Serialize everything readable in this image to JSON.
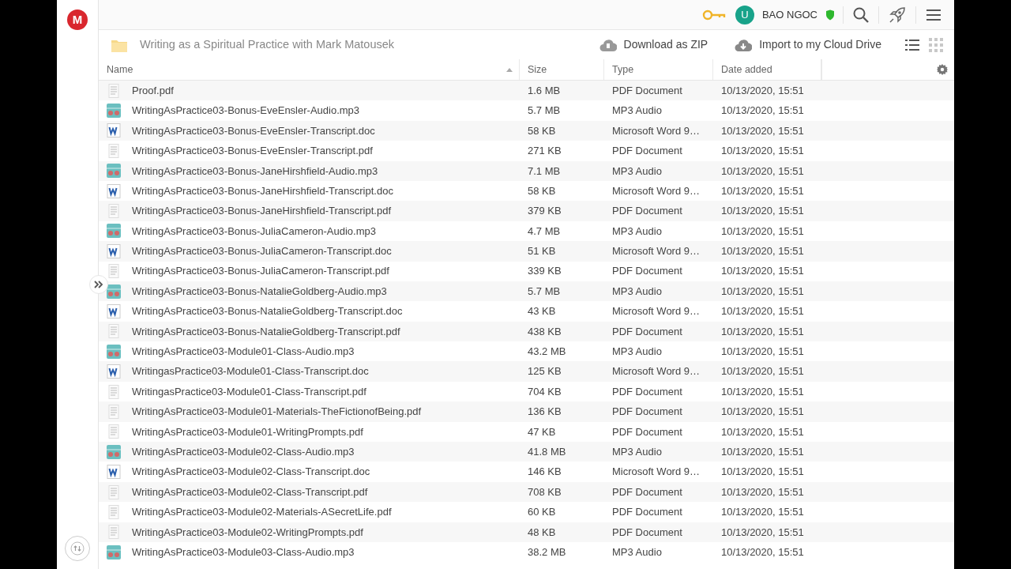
{
  "logo": {
    "letter": "M"
  },
  "topbar": {
    "user_initial": "U",
    "user_name": "BAO NGOC"
  },
  "folder": {
    "title": "Writing as a Spiritual Practice with Mark Matousek"
  },
  "actions": [
    {
      "label": "Download as ZIP",
      "kind": "zip"
    },
    {
      "label": "Import to my Cloud Drive",
      "kind": "cloud"
    }
  ],
  "view_modes": [
    {
      "kind": "list",
      "selected": true
    },
    {
      "kind": "grid",
      "selected": false
    }
  ],
  "table": {
    "columns": [
      {
        "label": "Name",
        "sorted": true
      },
      {
        "label": "Size",
        "sorted": false
      },
      {
        "label": "Type",
        "sorted": false
      },
      {
        "label": "Date added",
        "sorted": false
      }
    ],
    "rows": [
      {
        "kind": "pdf",
        "name": "Proof.pdf",
        "size": "1.6 MB",
        "type": "PDF Document",
        "date": "10/13/2020, 15:51"
      },
      {
        "kind": "mp3",
        "name": "WritingAsPractice03-Bonus-EveEnsler-Audio.mp3",
        "size": "5.7 MB",
        "type": "MP3 Audio",
        "date": "10/13/2020, 15:51"
      },
      {
        "kind": "doc",
        "name": "WritingAsPractice03-Bonus-EveEnsler-Transcript.doc",
        "size": "58 KB",
        "type": "Microsoft Word 9…",
        "date": "10/13/2020, 15:51"
      },
      {
        "kind": "pdf",
        "name": "WritingAsPractice03-Bonus-EveEnsler-Transcript.pdf",
        "size": "271 KB",
        "type": "PDF Document",
        "date": "10/13/2020, 15:51"
      },
      {
        "kind": "mp3",
        "name": "WritingAsPractice03-Bonus-JaneHirshfield-Audio.mp3",
        "size": "7.1 MB",
        "type": "MP3 Audio",
        "date": "10/13/2020, 15:51"
      },
      {
        "kind": "doc",
        "name": "WritingAsPractice03-Bonus-JaneHirshfield-Transcript.doc",
        "size": "58 KB",
        "type": "Microsoft Word 9…",
        "date": "10/13/2020, 15:51"
      },
      {
        "kind": "pdf",
        "name": "WritingAsPractice03-Bonus-JaneHirshfield-Transcript.pdf",
        "size": "379 KB",
        "type": "PDF Document",
        "date": "10/13/2020, 15:51"
      },
      {
        "kind": "mp3",
        "name": "WritingAsPractice03-Bonus-JuliaCameron-Audio.mp3",
        "size": "4.7 MB",
        "type": "MP3 Audio",
        "date": "10/13/2020, 15:51"
      },
      {
        "kind": "doc",
        "name": "WritingAsPractice03-Bonus-JuliaCameron-Transcript.doc",
        "size": "51 KB",
        "type": "Microsoft Word 9…",
        "date": "10/13/2020, 15:51"
      },
      {
        "kind": "pdf",
        "name": "WritingAsPractice03-Bonus-JuliaCameron-Transcript.pdf",
        "size": "339 KB",
        "type": "PDF Document",
        "date": "10/13/2020, 15:51"
      },
      {
        "kind": "mp3",
        "name": "WritingAsPractice03-Bonus-NatalieGoldberg-Audio.mp3",
        "size": "5.7 MB",
        "type": "MP3 Audio",
        "date": "10/13/2020, 15:51"
      },
      {
        "kind": "doc",
        "name": "WritingAsPractice03-Bonus-NatalieGoldberg-Transcript.doc",
        "size": "43 KB",
        "type": "Microsoft Word 9…",
        "date": "10/13/2020, 15:51"
      },
      {
        "kind": "pdf",
        "name": "WritingAsPractice03-Bonus-NatalieGoldberg-Transcript.pdf",
        "size": "438 KB",
        "type": "PDF Document",
        "date": "10/13/2020, 15:51"
      },
      {
        "kind": "mp3",
        "name": "WritingAsPractice03-Module01-Class-Audio.mp3",
        "size": "43.2 MB",
        "type": "MP3 Audio",
        "date": "10/13/2020, 15:51"
      },
      {
        "kind": "doc",
        "name": "WritingasPractice03-Module01-Class-Transcript.doc",
        "size": "125 KB",
        "type": "Microsoft Word 9…",
        "date": "10/13/2020, 15:51"
      },
      {
        "kind": "pdf",
        "name": "WritingasPractice03-Module01-Class-Transcript.pdf",
        "size": "704 KB",
        "type": "PDF Document",
        "date": "10/13/2020, 15:51"
      },
      {
        "kind": "pdf",
        "name": "WritingAsPractice03-Module01-Materials-TheFictionofBeing.pdf",
        "size": "136 KB",
        "type": "PDF Document",
        "date": "10/13/2020, 15:51"
      },
      {
        "kind": "pdf",
        "name": "WritingAsPractice03-Module01-WritingPrompts.pdf",
        "size": "47 KB",
        "type": "PDF Document",
        "date": "10/13/2020, 15:51"
      },
      {
        "kind": "mp3",
        "name": "WritingAsPractice03-Module02-Class-Audio.mp3",
        "size": "41.8 MB",
        "type": "MP3 Audio",
        "date": "10/13/2020, 15:51"
      },
      {
        "kind": "doc",
        "name": "WritingAsPractice03-Module02-Class-Transcript.doc",
        "size": "146 KB",
        "type": "Microsoft Word 9…",
        "date": "10/13/2020, 15:51"
      },
      {
        "kind": "pdf",
        "name": "WritingAsPractice03-Module02-Class-Transcript.pdf",
        "size": "708 KB",
        "type": "PDF Document",
        "date": "10/13/2020, 15:51"
      },
      {
        "kind": "pdf",
        "name": "WritingAsPractice03-Module02-Materials-ASecretLife.pdf",
        "size": "60 KB",
        "type": "PDF Document",
        "date": "10/13/2020, 15:51"
      },
      {
        "kind": "pdf",
        "name": "WritingAsPractice03-Module02-WritingPrompts.pdf",
        "size": "48 KB",
        "type": "PDF Document",
        "date": "10/13/2020, 15:51"
      },
      {
        "kind": "mp3",
        "name": "WritingAsPractice03-Module03-Class-Audio.mp3",
        "size": "38.2 MB",
        "type": "MP3 Audio",
        "date": "10/13/2020, 15:51"
      }
    ]
  }
}
